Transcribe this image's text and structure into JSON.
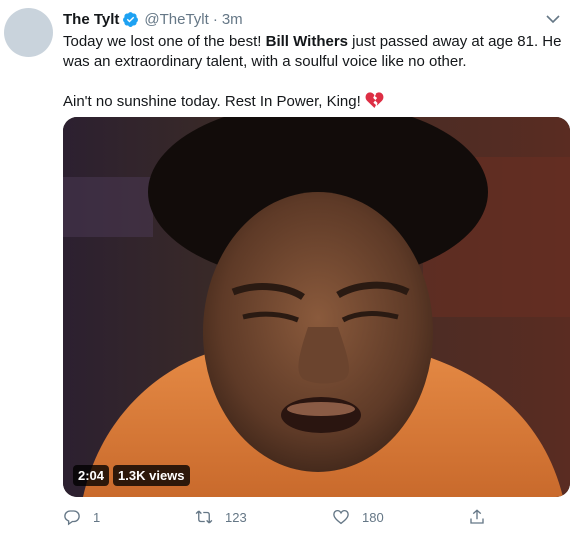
{
  "tweet": {
    "author_name": "The Tylt",
    "handle": "@TheTylt",
    "separator": "·",
    "time": "3m",
    "text_line1_pre": "Today we lost one of the best! ",
    "text_line1_bold": "Bill Withers",
    "text_line1_post": " just passed away at age 81. He was an extraordinary talent, with a soulful voice like no other.",
    "text_line2": "Ain't no sunshine today. Rest In Power, King!",
    "emoji": "broken-heart-icon"
  },
  "video": {
    "duration": "2:04",
    "views": "1.3K views"
  },
  "actions": {
    "replies": "1",
    "retweets": "123",
    "likes": "180"
  },
  "colors": {
    "verified": "#1da1f2",
    "secondary_text": "#657786",
    "broken_heart": "#dd2e44"
  }
}
